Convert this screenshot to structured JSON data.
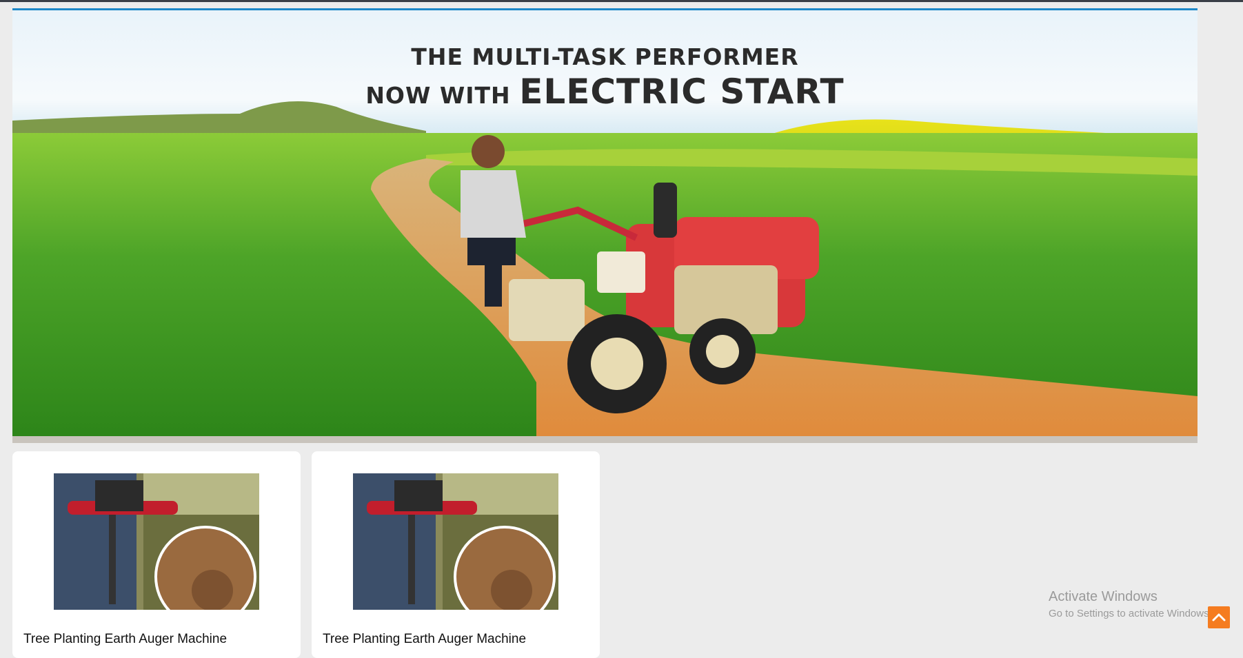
{
  "banner": {
    "line1": "THE MULTI-TASK PERFORMER",
    "line2_prefix": "NOW WITH",
    "line2_emphasis": "ELECTRIC START"
  },
  "products": [
    {
      "title": "Tree Planting Earth Auger Machine"
    },
    {
      "title": "Tree Planting Earth Auger Machine"
    }
  ],
  "watermark": {
    "title": "Activate Windows",
    "subtitle": "Go to Settings to activate Windows."
  },
  "icons": {
    "scroll_top": "chevron-up-icon"
  },
  "colors": {
    "accent": "#f57c20",
    "banner_border": "#1e88c8"
  }
}
